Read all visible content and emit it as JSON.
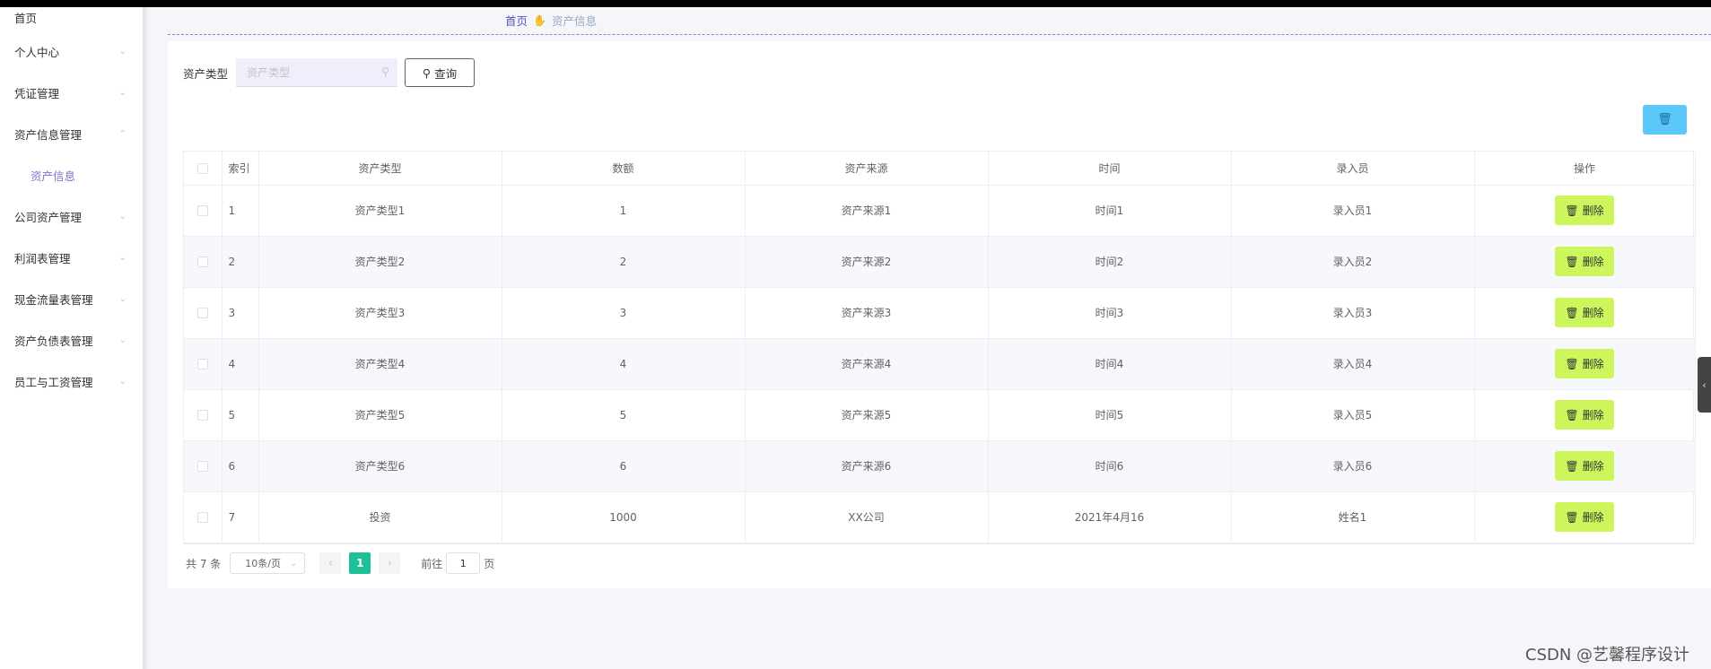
{
  "breadcrumb": {
    "home": "首页",
    "current": "资产信息"
  },
  "sidebar": {
    "items": [
      {
        "label": "首页"
      },
      {
        "label": "个人中心"
      },
      {
        "label": "凭证管理"
      },
      {
        "label": "资产信息管理"
      },
      {
        "label": "资产信息"
      },
      {
        "label": "公司资产管理"
      },
      {
        "label": "利润表管理"
      },
      {
        "label": "现金流量表管理"
      },
      {
        "label": "资产负债表管理"
      },
      {
        "label": "员工与工资管理"
      }
    ]
  },
  "search": {
    "label": "资产类型",
    "placeholder": "资产类型",
    "query_label": "查询"
  },
  "table": {
    "headers": [
      "索引",
      "资产类型",
      "数额",
      "资产来源",
      "时间",
      "录入员",
      "操作"
    ],
    "delete_label": "删除",
    "rows": [
      [
        "1",
        "资产类型1",
        "1",
        "资产来源1",
        "时间1",
        "录入员1"
      ],
      [
        "2",
        "资产类型2",
        "2",
        "资产来源2",
        "时间2",
        "录入员2"
      ],
      [
        "3",
        "资产类型3",
        "3",
        "资产来源3",
        "时间3",
        "录入员3"
      ],
      [
        "4",
        "资产类型4",
        "4",
        "资产来源4",
        "时间4",
        "录入员4"
      ],
      [
        "5",
        "资产类型5",
        "5",
        "资产来源5",
        "时间5",
        "录入员5"
      ],
      [
        "6",
        "资产类型6",
        "6",
        "资产来源6",
        "时间6",
        "录入员6"
      ],
      [
        "7",
        "投资",
        "1000",
        "XX公司",
        "2021年4月16",
        "姓名1"
      ]
    ]
  },
  "pagination": {
    "total": "共 7 条",
    "page_size": "10条/页",
    "current_page": "1",
    "goto_prefix": "前往",
    "goto_value": "1",
    "goto_suffix": "页"
  },
  "watermark": "CSDN @艺馨程序设计",
  "colors": {
    "accent": "#5a4fc4",
    "delete_button": "#ccf65b",
    "batch_delete_button": "#5ac8fa",
    "active_page": "#1fbf9a"
  }
}
